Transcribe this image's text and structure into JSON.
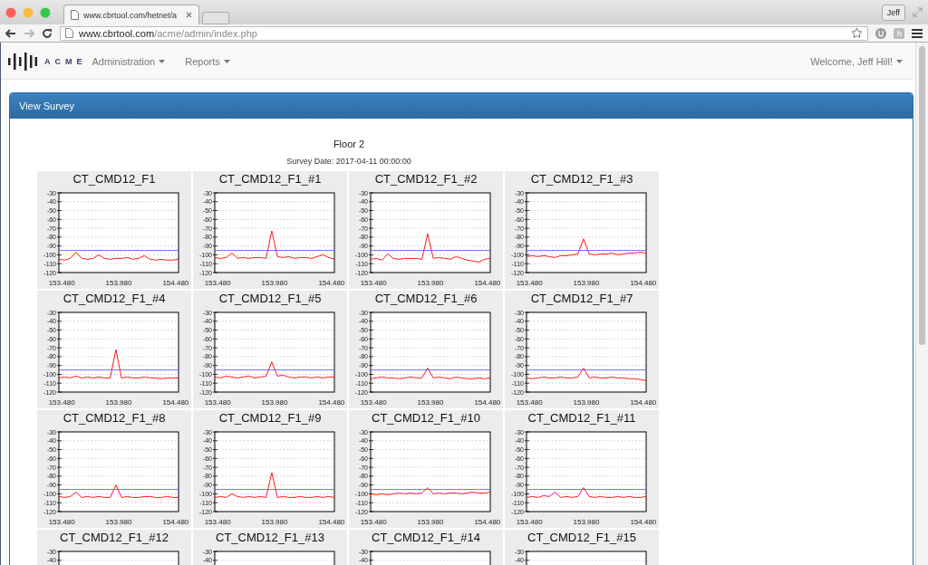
{
  "browser": {
    "tab_title": "www.cbrtool.com/hetnet/a",
    "url": "**www.cbrtool.com**/acme/admin/index.php",
    "profile": "Jeff"
  },
  "navbar": {
    "brand": "ACME",
    "menus": [
      {
        "label": "Administration"
      },
      {
        "label": "Reports"
      }
    ],
    "user_menu": "Welcome, Jeff Hill!"
  },
  "panel": {
    "title": "View Survey",
    "heading": "Floor 2",
    "survey_date": "Survey Date: 2017-04-11 00:00:00",
    "charts": [
      {
        "chart_data": {
          "type": "line",
          "title": "CT_CMD12_F1",
          "grid": true,
          "x": [
            153.455,
            153.505,
            153.555,
            153.605,
            153.655,
            153.705,
            153.755,
            153.805,
            153.855,
            153.905,
            153.955,
            154.005,
            154.055,
            154.105,
            154.155,
            154.205,
            154.255,
            154.305,
            154.355,
            154.405,
            154.455,
            154.505
          ],
          "xlim": [
            153.455,
            154.505
          ],
          "ylim": [
            -120,
            -30
          ],
          "xticks": [
            {
              "value": 153.48,
              "label": "153.480"
            },
            {
              "value": 153.98,
              "label": "153.980"
            },
            {
              "value": 154.48,
              "label": "154.480"
            }
          ],
          "yticks": [
            -30,
            -40,
            -50,
            -60,
            -70,
            -80,
            -90,
            -100,
            -110,
            -120
          ],
          "series": [
            {
              "color": "#ff0000",
              "values": [
                -105,
                -106,
                -104,
                -97,
                -104,
                -105,
                -104,
                -100,
                -104,
                -105,
                -104,
                -104,
                -103,
                -105,
                -104,
                -101,
                -105,
                -106,
                -105,
                -106,
                -106,
                -105
              ]
            },
            {
              "color": "#5a5aff",
              "values": [
                -95,
                -95,
                -95,
                -95,
                -95,
                -95,
                -95,
                -95,
                -95,
                -95,
                -95,
                -95,
                -95,
                -95,
                -95,
                -95,
                -95,
                -95,
                -95,
                -95,
                -95,
                -95
              ]
            }
          ]
        }
      },
      {
        "chart_data": {
          "type": "line",
          "title": "CT_CMD12_F1_#1",
          "grid": true,
          "x": [
            153.455,
            153.505,
            153.555,
            153.605,
            153.655,
            153.705,
            153.755,
            153.805,
            153.855,
            153.905,
            153.955,
            154.005,
            154.055,
            154.105,
            154.155,
            154.205,
            154.255,
            154.305,
            154.355,
            154.405,
            154.455,
            154.505
          ],
          "xlim": [
            153.455,
            154.505
          ],
          "ylim": [
            -120,
            -30
          ],
          "xticks": [
            {
              "value": 153.48,
              "label": "153.480"
            },
            {
              "value": 153.98,
              "label": "153.980"
            },
            {
              "value": 154.48,
              "label": "154.480"
            }
          ],
          "yticks": [
            -30,
            -40,
            -50,
            -60,
            -70,
            -80,
            -90,
            -100,
            -110,
            -120
          ],
          "series": [
            {
              "color": "#ff0000",
              "values": [
                -103,
                -104,
                -103,
                -98,
                -104,
                -103,
                -104,
                -103,
                -103,
                -104,
                -73,
                -102,
                -103,
                -102,
                -104,
                -103,
                -103,
                -104,
                -102,
                -100,
                -103,
                -105
              ]
            },
            {
              "color": "#5a5aff",
              "values": [
                -95,
                -95,
                -95,
                -95,
                -95,
                -95,
                -95,
                -95,
                -95,
                -95,
                -95,
                -95,
                -95,
                -95,
                -95,
                -95,
                -95,
                -95,
                -95,
                -95,
                -95,
                -95
              ]
            }
          ]
        }
      },
      {
        "chart_data": {
          "type": "line",
          "title": "CT_CMD12_F1_#2",
          "grid": true,
          "x": [
            153.455,
            153.505,
            153.555,
            153.605,
            153.655,
            153.705,
            153.755,
            153.805,
            153.855,
            153.905,
            153.955,
            154.005,
            154.055,
            154.105,
            154.155,
            154.205,
            154.255,
            154.305,
            154.355,
            154.405,
            154.455,
            154.505
          ],
          "xlim": [
            153.455,
            154.505
          ],
          "ylim": [
            -120,
            -30
          ],
          "xticks": [
            {
              "value": 153.48,
              "label": "153.480"
            },
            {
              "value": 153.98,
              "label": "153.980"
            },
            {
              "value": 154.48,
              "label": "154.480"
            }
          ],
          "yticks": [
            -30,
            -40,
            -50,
            -60,
            -70,
            -80,
            -90,
            -100,
            -110,
            -120
          ],
          "series": [
            {
              "color": "#ff0000",
              "values": [
                -105,
                -104,
                -106,
                -99,
                -104,
                -105,
                -104,
                -104,
                -104,
                -105,
                -76,
                -104,
                -103,
                -104,
                -105,
                -102,
                -104,
                -106,
                -107,
                -108,
                -105,
                -104
              ]
            },
            {
              "color": "#5a5aff",
              "values": [
                -95,
                -95,
                -95,
                -95,
                -95,
                -95,
                -95,
                -95,
                -95,
                -95,
                -95,
                -95,
                -95,
                -95,
                -95,
                -95,
                -95,
                -95,
                -95,
                -95,
                -95,
                -95
              ]
            }
          ]
        }
      },
      {
        "chart_data": {
          "type": "line",
          "title": "CT_CMD12_F1_#3",
          "grid": true,
          "x": [
            153.455,
            153.505,
            153.555,
            153.605,
            153.655,
            153.705,
            153.755,
            153.805,
            153.855,
            153.905,
            153.955,
            154.005,
            154.055,
            154.105,
            154.155,
            154.205,
            154.255,
            154.305,
            154.355,
            154.405,
            154.455,
            154.505
          ],
          "xlim": [
            153.455,
            154.505
          ],
          "ylim": [
            -120,
            -30
          ],
          "xticks": [
            {
              "value": 153.48,
              "label": "153.480"
            },
            {
              "value": 153.98,
              "label": "153.980"
            },
            {
              "value": 154.48,
              "label": "154.480"
            }
          ],
          "yticks": [
            -30,
            -40,
            -50,
            -60,
            -70,
            -80,
            -90,
            -100,
            -110,
            -120
          ],
          "series": [
            {
              "color": "#ff0000",
              "values": [
                -102,
                -101,
                -102,
                -101,
                -102,
                -103,
                -101,
                -101,
                -100,
                -99,
                -82,
                -99,
                -100,
                -99,
                -99,
                -98,
                -100,
                -99,
                -98,
                -98,
                -97,
                -98
              ]
            },
            {
              "color": "#5a5aff",
              "values": [
                -95,
                -95,
                -95,
                -95,
                -95,
                -95,
                -95,
                -95,
                -95,
                -95,
                -95,
                -95,
                -95,
                -95,
                -95,
                -95,
                -95,
                -95,
                -95,
                -95,
                -95,
                -95
              ]
            }
          ]
        }
      },
      {
        "chart_data": {
          "type": "line",
          "title": "CT_CMD12_F1_#4",
          "grid": true,
          "x": [
            153.455,
            153.505,
            153.555,
            153.605,
            153.655,
            153.705,
            153.755,
            153.805,
            153.855,
            153.905,
            153.955,
            154.005,
            154.055,
            154.105,
            154.155,
            154.205,
            154.255,
            154.305,
            154.355,
            154.405,
            154.455,
            154.505
          ],
          "xlim": [
            153.455,
            154.505
          ],
          "ylim": [
            -120,
            -30
          ],
          "xticks": [
            {
              "value": 153.48,
              "label": "153.480"
            },
            {
              "value": 153.98,
              "label": "153.980"
            },
            {
              "value": 154.48,
              "label": "154.480"
            }
          ],
          "yticks": [
            -30,
            -40,
            -50,
            -60,
            -70,
            -80,
            -90,
            -100,
            -110,
            -120
          ],
          "series": [
            {
              "color": "#ff0000",
              "values": [
                -104,
                -103,
                -104,
                -102,
                -104,
                -103,
                -104,
                -103,
                -104,
                -104,
                -72,
                -104,
                -103,
                -104,
                -104,
                -103,
                -104,
                -104,
                -105,
                -104,
                -104,
                -104
              ]
            },
            {
              "color": "#5a5aff",
              "values": [
                -95,
                -95,
                -95,
                -95,
                -95,
                -95,
                -95,
                -95,
                -95,
                -95,
                -95,
                -95,
                -95,
                -95,
                -95,
                -95,
                -95,
                -95,
                -95,
                -95,
                -95,
                -95
              ]
            }
          ]
        }
      },
      {
        "chart_data": {
          "type": "line",
          "title": "CT_CMD12_F1_#5",
          "grid": true,
          "x": [
            153.455,
            153.505,
            153.555,
            153.605,
            153.655,
            153.705,
            153.755,
            153.805,
            153.855,
            153.905,
            153.955,
            154.005,
            154.055,
            154.105,
            154.155,
            154.205,
            154.255,
            154.305,
            154.355,
            154.405,
            154.455,
            154.505
          ],
          "xlim": [
            153.455,
            154.505
          ],
          "ylim": [
            -120,
            -30
          ],
          "xticks": [
            {
              "value": 153.48,
              "label": "153.480"
            },
            {
              "value": 153.98,
              "label": "153.980"
            },
            {
              "value": 154.48,
              "label": "154.480"
            }
          ],
          "yticks": [
            -30,
            -40,
            -50,
            -60,
            -70,
            -80,
            -90,
            -100,
            -110,
            -120
          ],
          "series": [
            {
              "color": "#ff0000",
              "values": [
                -103,
                -104,
                -102,
                -103,
                -104,
                -103,
                -102,
                -104,
                -103,
                -102,
                -86,
                -102,
                -101,
                -103,
                -104,
                -103,
                -103,
                -104,
                -103,
                -104,
                -103,
                -103
              ]
            },
            {
              "color": "#5a5aff",
              "values": [
                -95,
                -95,
                -95,
                -95,
                -95,
                -95,
                -95,
                -95,
                -95,
                -95,
                -95,
                -95,
                -95,
                -95,
                -95,
                -95,
                -95,
                -95,
                -95,
                -95,
                -95,
                -95
              ]
            }
          ]
        }
      },
      {
        "chart_data": {
          "type": "line",
          "title": "CT_CMD12_F1_#6",
          "grid": true,
          "x": [
            153.455,
            153.505,
            153.555,
            153.605,
            153.655,
            153.705,
            153.755,
            153.805,
            153.855,
            153.905,
            153.955,
            154.005,
            154.055,
            154.105,
            154.155,
            154.205,
            154.255,
            154.305,
            154.355,
            154.405,
            154.455,
            154.505
          ],
          "xlim": [
            153.455,
            154.505
          ],
          "ylim": [
            -120,
            -30
          ],
          "xticks": [
            {
              "value": 153.48,
              "label": "153.480"
            },
            {
              "value": 153.98,
              "label": "153.980"
            },
            {
              "value": 154.48,
              "label": "154.480"
            }
          ],
          "yticks": [
            -30,
            -40,
            -50,
            -60,
            -70,
            -80,
            -90,
            -100,
            -110,
            -120
          ],
          "series": [
            {
              "color": "#ff0000",
              "values": [
                -105,
                -104,
                -103,
                -104,
                -104,
                -105,
                -104,
                -103,
                -104,
                -104,
                -93,
                -104,
                -103,
                -104,
                -105,
                -103,
                -104,
                -105,
                -105,
                -104,
                -105,
                -104
              ]
            },
            {
              "color": "#5a5aff",
              "values": [
                -95,
                -95,
                -95,
                -95,
                -95,
                -95,
                -95,
                -95,
                -95,
                -95,
                -95,
                -95,
                -95,
                -95,
                -95,
                -95,
                -95,
                -95,
                -95,
                -95,
                -95,
                -95
              ]
            }
          ]
        }
      },
      {
        "chart_data": {
          "type": "line",
          "title": "CT_CMD12_F1_#7",
          "grid": true,
          "x": [
            153.455,
            153.505,
            153.555,
            153.605,
            153.655,
            153.705,
            153.755,
            153.805,
            153.855,
            153.905,
            153.955,
            154.005,
            154.055,
            154.105,
            154.155,
            154.205,
            154.255,
            154.305,
            154.355,
            154.405,
            154.455,
            154.505
          ],
          "xlim": [
            153.455,
            154.505
          ],
          "ylim": [
            -120,
            -30
          ],
          "xticks": [
            {
              "value": 153.48,
              "label": "153.480"
            },
            {
              "value": 153.98,
              "label": "153.980"
            },
            {
              "value": 154.48,
              "label": "154.480"
            }
          ],
          "yticks": [
            -30,
            -40,
            -50,
            -60,
            -70,
            -80,
            -90,
            -100,
            -110,
            -120
          ],
          "series": [
            {
              "color": "#ff0000",
              "values": [
                -104,
                -105,
                -104,
                -103,
                -104,
                -104,
                -103,
                -104,
                -104,
                -103,
                -93,
                -104,
                -103,
                -104,
                -104,
                -103,
                -104,
                -104,
                -105,
                -105,
                -106,
                -107
              ]
            },
            {
              "color": "#5a5aff",
              "values": [
                -95,
                -95,
                -95,
                -95,
                -95,
                -95,
                -95,
                -95,
                -95,
                -95,
                -95,
                -95,
                -95,
                -95,
                -95,
                -95,
                -95,
                -95,
                -95,
                -95,
                -95,
                -95
              ]
            }
          ]
        }
      },
      {
        "chart_data": {
          "type": "line",
          "title": "CT_CMD12_F1_#8",
          "grid": true,
          "x": [
            153.455,
            153.505,
            153.555,
            153.605,
            153.655,
            153.705,
            153.755,
            153.805,
            153.855,
            153.905,
            153.955,
            154.005,
            154.055,
            154.105,
            154.155,
            154.205,
            154.255,
            154.305,
            154.355,
            154.405,
            154.455,
            154.505
          ],
          "xlim": [
            153.455,
            154.505
          ],
          "ylim": [
            -120,
            -30
          ],
          "xticks": [
            {
              "value": 153.48,
              "label": "153.480"
            },
            {
              "value": 153.98,
              "label": "153.980"
            },
            {
              "value": 154.48,
              "label": "154.480"
            }
          ],
          "yticks": [
            -30,
            -40,
            -50,
            -60,
            -70,
            -80,
            -90,
            -100,
            -110,
            -120
          ],
          "series": [
            {
              "color": "#ff0000",
              "values": [
                -103,
                -104,
                -103,
                -98,
                -104,
                -103,
                -104,
                -103,
                -104,
                -104,
                -90,
                -104,
                -103,
                -104,
                -104,
                -103,
                -103,
                -104,
                -104,
                -103,
                -104,
                -104
              ]
            },
            {
              "color": "#5a5aff",
              "values": [
                -95,
                -95,
                -95,
                -95,
                -95,
                -95,
                -95,
                -95,
                -95,
                -95,
                -95,
                -95,
                -95,
                -95,
                -95,
                -95,
                -95,
                -95,
                -95,
                -95,
                -95,
                -95
              ]
            }
          ]
        }
      },
      {
        "chart_data": {
          "type": "line",
          "title": "CT_CMD12_F1_#9",
          "grid": true,
          "x": [
            153.455,
            153.505,
            153.555,
            153.605,
            153.655,
            153.705,
            153.755,
            153.805,
            153.855,
            153.905,
            153.955,
            154.005,
            154.055,
            154.105,
            154.155,
            154.205,
            154.255,
            154.305,
            154.355,
            154.405,
            154.455,
            154.505
          ],
          "xlim": [
            153.455,
            154.505
          ],
          "ylim": [
            -120,
            -30
          ],
          "xticks": [
            {
              "value": 153.48,
              "label": "153.480"
            },
            {
              "value": 153.98,
              "label": "153.980"
            },
            {
              "value": 154.48,
              "label": "154.480"
            }
          ],
          "yticks": [
            -30,
            -40,
            -50,
            -60,
            -70,
            -80,
            -90,
            -100,
            -110,
            -120
          ],
          "series": [
            {
              "color": "#ff0000",
              "values": [
                -104,
                -103,
                -104,
                -100,
                -103,
                -104,
                -103,
                -104,
                -103,
                -104,
                -76,
                -104,
                -103,
                -104,
                -104,
                -103,
                -104,
                -104,
                -103,
                -104,
                -103,
                -104
              ]
            },
            {
              "color": "#5a5aff",
              "values": [
                -95,
                -95,
                -95,
                -95,
                -95,
                -95,
                -95,
                -95,
                -95,
                -95,
                -95,
                -95,
                -95,
                -95,
                -95,
                -95,
                -95,
                -95,
                -95,
                -95,
                -95,
                -95
              ]
            }
          ]
        }
      },
      {
        "chart_data": {
          "type": "line",
          "title": "CT_CMD12_F1_#10",
          "grid": true,
          "x": [
            153.455,
            153.505,
            153.555,
            153.605,
            153.655,
            153.705,
            153.755,
            153.805,
            153.855,
            153.905,
            153.955,
            154.005,
            154.055,
            154.105,
            154.155,
            154.205,
            154.255,
            154.305,
            154.355,
            154.405,
            154.455,
            154.505
          ],
          "xlim": [
            153.455,
            154.505
          ],
          "ylim": [
            -120,
            -30
          ],
          "xticks": [
            {
              "value": 153.48,
              "label": "153.480"
            },
            {
              "value": 153.98,
              "label": "153.980"
            },
            {
              "value": 154.48,
              "label": "154.480"
            }
          ],
          "yticks": [
            -30,
            -40,
            -50,
            -60,
            -70,
            -80,
            -90,
            -100,
            -110,
            -120
          ],
          "series": [
            {
              "color": "#ff0000",
              "values": [
                -100,
                -101,
                -100,
                -101,
                -100,
                -99,
                -100,
                -99,
                -100,
                -99,
                -93,
                -100,
                -99,
                -100,
                -99,
                -99,
                -100,
                -99,
                -98,
                -99,
                -99,
                -98
              ]
            },
            {
              "color": "#5a5aff",
              "values": [
                -95,
                -95,
                -95,
                -95,
                -95,
                -95,
                -95,
                -95,
                -95,
                -95,
                -95,
                -95,
                -95,
                -95,
                -95,
                -95,
                -95,
                -95,
                -95,
                -95,
                -95,
                -95
              ]
            }
          ]
        }
      },
      {
        "chart_data": {
          "type": "line",
          "title": "CT_CMD12_F1_#11",
          "grid": true,
          "x": [
            153.455,
            153.505,
            153.555,
            153.605,
            153.655,
            153.705,
            153.755,
            153.805,
            153.855,
            153.905,
            153.955,
            154.005,
            154.055,
            154.105,
            154.155,
            154.205,
            154.255,
            154.305,
            154.355,
            154.405,
            154.455,
            154.505
          ],
          "xlim": [
            153.455,
            154.505
          ],
          "ylim": [
            -120,
            -30
          ],
          "xticks": [
            {
              "value": 153.48,
              "label": "153.480"
            },
            {
              "value": 153.98,
              "label": "153.980"
            },
            {
              "value": 154.48,
              "label": "154.480"
            }
          ],
          "yticks": [
            -30,
            -40,
            -50,
            -60,
            -70,
            -80,
            -90,
            -100,
            -110,
            -120
          ],
          "series": [
            {
              "color": "#ff0000",
              "values": [
                -104,
                -103,
                -104,
                -102,
                -103,
                -98,
                -104,
                -103,
                -104,
                -103,
                -93,
                -103,
                -104,
                -103,
                -104,
                -104,
                -103,
                -104,
                -103,
                -104,
                -104,
                -103
              ]
            },
            {
              "color": "#5a5aff",
              "values": [
                -95,
                -95,
                -95,
                -95,
                -95,
                -95,
                -95,
                -95,
                -95,
                -95,
                -95,
                -95,
                -95,
                -95,
                -95,
                -95,
                -95,
                -95,
                -95,
                -95,
                -95,
                -95
              ]
            }
          ]
        }
      },
      {
        "kind": "cut_off",
        "title": "CT_CMD12_F1_#12",
        "axis_labels": [
          {
            "text": "-30"
          },
          {
            "text": "-40"
          }
        ]
      },
      {
        "kind": "cut_off",
        "title": "CT_CMD12_F1_#13",
        "axis_labels": [
          {
            "text": "-30"
          },
          {
            "text": "-40"
          }
        ]
      },
      {
        "kind": "cut_off",
        "title": "CT_CMD12_F1_#14",
        "axis_labels": [
          {
            "text": "-30"
          },
          {
            "text": "-40"
          }
        ]
      },
      {
        "kind": "cut_off",
        "title": "CT_CMD12_F1_#15",
        "axis_labels": [
          {
            "text": "-30"
          },
          {
            "text": "-40"
          }
        ]
      }
    ]
  }
}
